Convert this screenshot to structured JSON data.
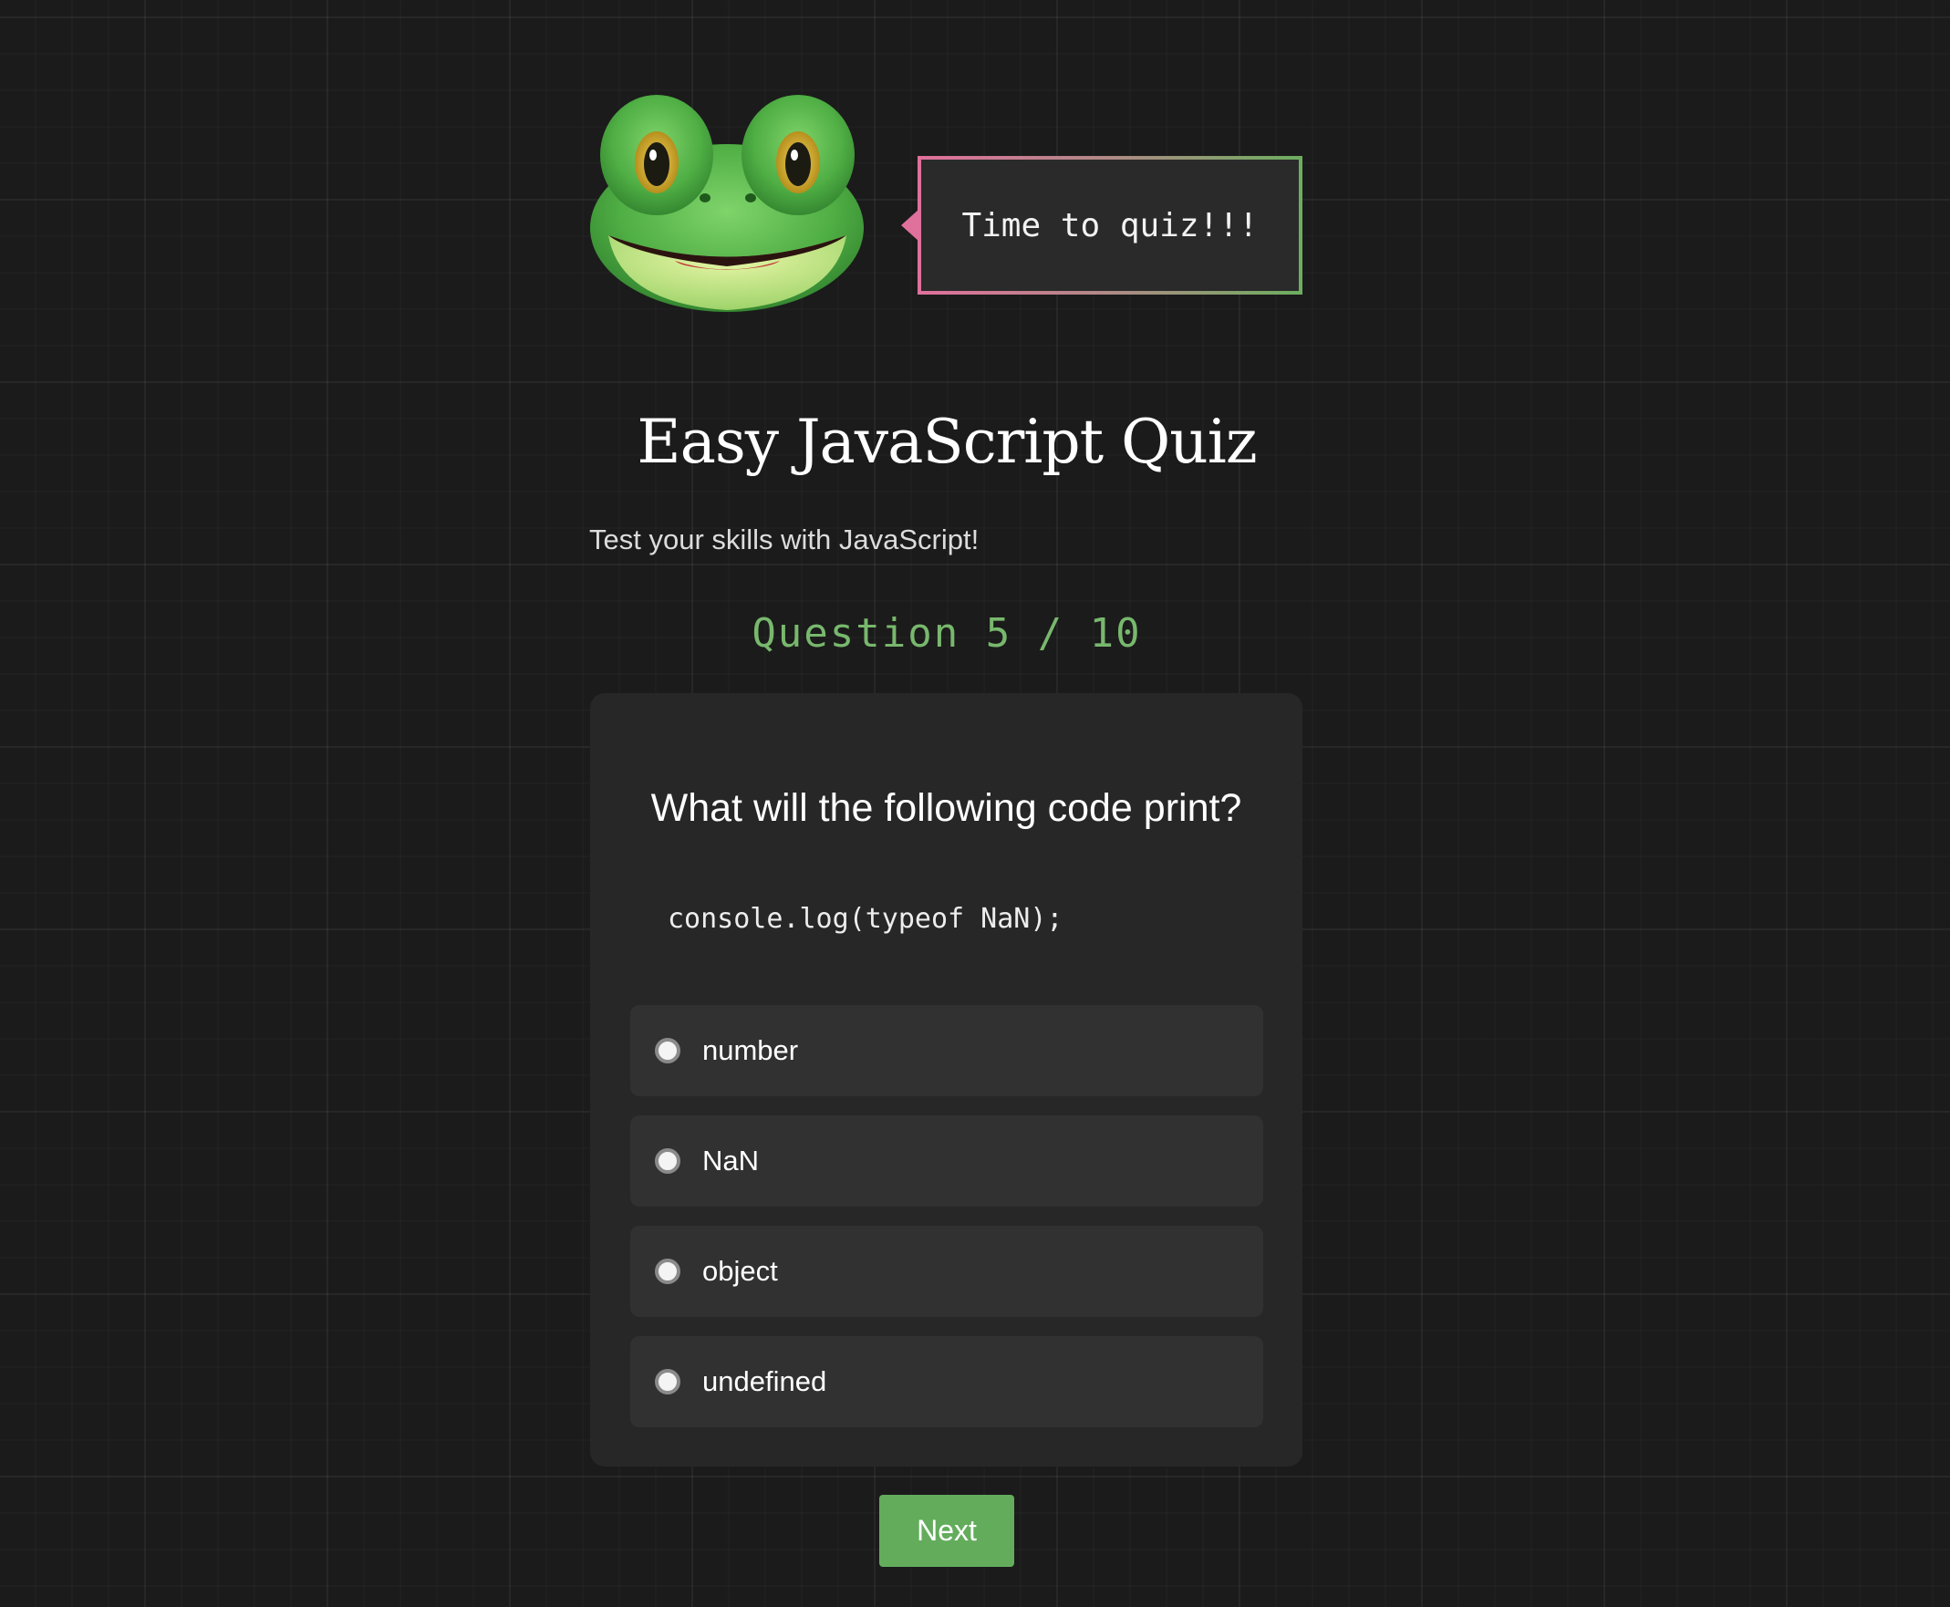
{
  "mascot": {
    "icon": "frog-icon",
    "speech": "Time to quiz!!!"
  },
  "header": {
    "title": "Easy JavaScript Quiz",
    "subtitle": "Test your skills with JavaScript!"
  },
  "progress": {
    "label": "Question 5 / 10",
    "current": 5,
    "total": 10
  },
  "question": {
    "prompt": "What will the following code print?",
    "code": "console.log(typeof NaN);",
    "options": [
      {
        "label": "number",
        "selected": false
      },
      {
        "label": "NaN",
        "selected": false
      },
      {
        "label": "object",
        "selected": false
      },
      {
        "label": "undefined",
        "selected": false
      }
    ]
  },
  "actions": {
    "next_label": "Next"
  },
  "colors": {
    "background": "#1b1b1b",
    "card": "#272727",
    "option": "#313131",
    "accent_green": "#63ac5c",
    "counter_green": "#78b86d",
    "bubble_pink": "#e0709c"
  }
}
